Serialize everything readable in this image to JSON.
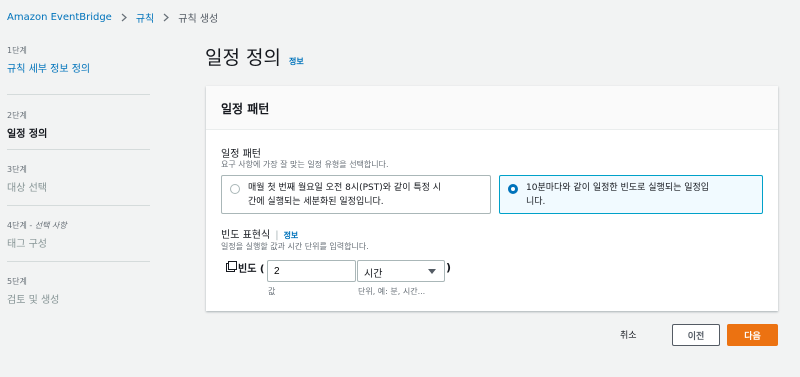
{
  "breadcrumb": {
    "root": "Amazon EventBridge",
    "section": "규칙",
    "current": "규칙 생성"
  },
  "steps": [
    {
      "num": "1단계",
      "optional": "",
      "title": "규칙 세부 정보 정의",
      "state": "link"
    },
    {
      "num": "2단계",
      "optional": "",
      "title": "일정 정의",
      "state": "active"
    },
    {
      "num": "3단계",
      "optional": "",
      "title": "대상 선택",
      "state": "disabled"
    },
    {
      "num": "4단계 - ",
      "optional": "선택 사항",
      "title": "태그 구성",
      "state": "disabled"
    },
    {
      "num": "5단계",
      "optional": "",
      "title": "검토 및 생성",
      "state": "disabled"
    }
  ],
  "page": {
    "title": "일정 정의",
    "info": "정보"
  },
  "panel": {
    "title": "일정 패턴"
  },
  "schedule_pattern": {
    "label": "일정 패턴",
    "description": "요구 사항에 가장 잘 맞는 일정 유형을 선택합니다.",
    "options": [
      {
        "line1": "매월 첫 번째 월요일 오전 8시(PST)와 같이 특정 시",
        "line2": "간에 실행되는 세분화된 일정입니다.",
        "selected": false
      },
      {
        "line1": "10분마다와 같이 일정한 빈도로 실행되는 일정입",
        "line2": "니다.",
        "selected": true
      }
    ]
  },
  "rate_expression": {
    "label": "빈도 표현식",
    "info": "정보",
    "description": "일정을 실행할 값과 시간 단위를 입력합니다.",
    "prefix": "빈도 (",
    "value": "2",
    "value_sublabel": "값",
    "unit": "시간",
    "unit_sublabel": "단위, 예: 분, 시간...",
    "suffix": ")"
  },
  "footer": {
    "cancel": "취소",
    "previous": "이전",
    "next": "다음"
  },
  "colors": {
    "link": "#0073bb",
    "primary_button": "#ec7211",
    "selected_border": "#00a1c9"
  }
}
